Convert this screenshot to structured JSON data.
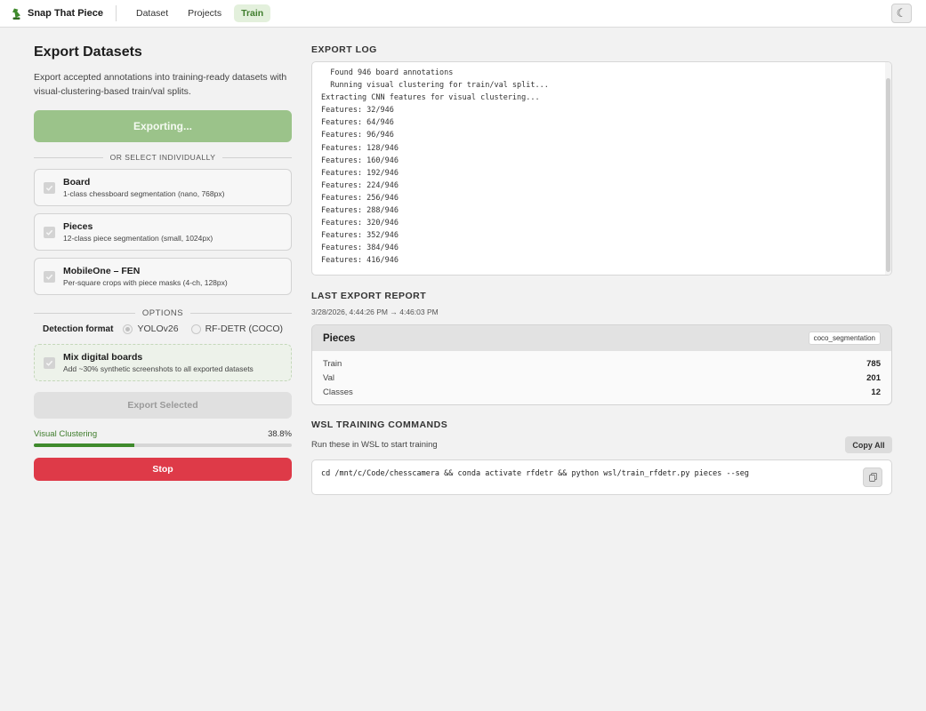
{
  "nav": {
    "brand": "Snap That Piece",
    "links": [
      "Dataset",
      "Projects",
      "Train"
    ],
    "active": "Train",
    "theme_icon": "moon-icon"
  },
  "left": {
    "title": "Export Datasets",
    "description": "Export accepted annotations into training-ready datasets with visual-clustering-based train/val splits.",
    "export_all_label": "Exporting...",
    "separator": "OR SELECT INDIVIDUALLY",
    "datasets": [
      {
        "title": "Board",
        "subtitle": "1-class chessboard segmentation (nano, 768px)",
        "checked": true
      },
      {
        "title": "Pieces",
        "subtitle": "12-class piece segmentation (small, 1024px)",
        "checked": true
      },
      {
        "title": "MobileOne – FEN",
        "subtitle": "Per-square crops with piece masks (4-ch, 128px)",
        "checked": true
      }
    ],
    "options_label": "OPTIONS",
    "format": {
      "label": "Detection format",
      "options": [
        "YOLOv26",
        "RF-DETR (COCO)"
      ],
      "selected": "YOLOv26"
    },
    "mix": {
      "title": "Mix digital boards",
      "subtitle": "Add ~30% synthetic screenshots to all exported datasets",
      "checked": true
    },
    "export_selected_label": "Export Selected",
    "progress": {
      "label": "Visual Clustering",
      "percent_text": "38.8%",
      "percent": 38.8
    },
    "stop_label": "Stop"
  },
  "log": {
    "title": "EXPORT LOG",
    "lines": [
      "  Found 946 board annotations",
      "  Running visual clustering for train/val split...",
      "Extracting CNN features for visual clustering...",
      "Features: 32/946",
      "Features: 64/946",
      "Features: 96/946",
      "Features: 128/946",
      "Features: 160/946",
      "Features: 192/946",
      "Features: 224/946",
      "Features: 256/946",
      "Features: 288/946",
      "Features: 320/946",
      "Features: 352/946",
      "Features: 384/946",
      "Features: 416/946"
    ]
  },
  "report": {
    "title": "LAST EXPORT REPORT",
    "time": "3/28/2026, 4:44:26 PM → 4:46:03 PM",
    "card": {
      "name": "Pieces",
      "badge": "coco_segmentation",
      "rows": [
        {
          "k": "Train",
          "v": "785"
        },
        {
          "k": "Val",
          "v": "201"
        },
        {
          "k": "Classes",
          "v": "12"
        }
      ]
    }
  },
  "wsl": {
    "title": "WSL TRAINING COMMANDS",
    "subtitle": "Run these in WSL to start training",
    "copy_all_label": "Copy All",
    "command": "cd /mnt/c/Code/chesscamera && conda activate rfdetr && python wsl/train_rfdetr.py pieces --seg"
  },
  "colors": {
    "accent_green": "#3f7d2c",
    "stop_red": "#de3a48",
    "export_btn": "#9bc38a"
  }
}
